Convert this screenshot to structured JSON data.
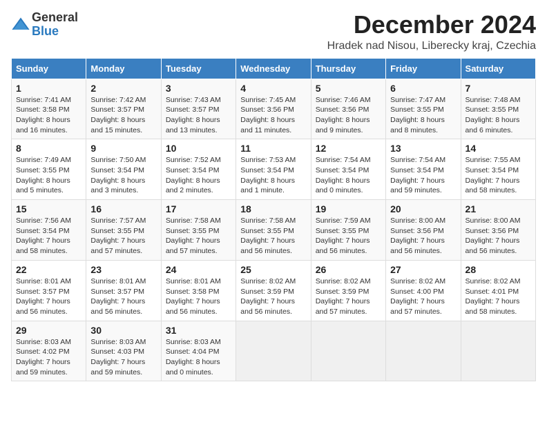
{
  "header": {
    "logo_general": "General",
    "logo_blue": "Blue",
    "title": "December 2024",
    "subtitle": "Hradek nad Nisou, Liberecky kraj, Czechia"
  },
  "weekdays": [
    "Sunday",
    "Monday",
    "Tuesday",
    "Wednesday",
    "Thursday",
    "Friday",
    "Saturday"
  ],
  "weeks": [
    [
      {
        "day": "1",
        "lines": [
          "Sunrise: 7:41 AM",
          "Sunset: 3:58 PM",
          "Daylight: 8 hours",
          "and 16 minutes."
        ]
      },
      {
        "day": "2",
        "lines": [
          "Sunrise: 7:42 AM",
          "Sunset: 3:57 PM",
          "Daylight: 8 hours",
          "and 15 minutes."
        ]
      },
      {
        "day": "3",
        "lines": [
          "Sunrise: 7:43 AM",
          "Sunset: 3:57 PM",
          "Daylight: 8 hours",
          "and 13 minutes."
        ]
      },
      {
        "day": "4",
        "lines": [
          "Sunrise: 7:45 AM",
          "Sunset: 3:56 PM",
          "Daylight: 8 hours",
          "and 11 minutes."
        ]
      },
      {
        "day": "5",
        "lines": [
          "Sunrise: 7:46 AM",
          "Sunset: 3:56 PM",
          "Daylight: 8 hours",
          "and 9 minutes."
        ]
      },
      {
        "day": "6",
        "lines": [
          "Sunrise: 7:47 AM",
          "Sunset: 3:55 PM",
          "Daylight: 8 hours",
          "and 8 minutes."
        ]
      },
      {
        "day": "7",
        "lines": [
          "Sunrise: 7:48 AM",
          "Sunset: 3:55 PM",
          "Daylight: 8 hours",
          "and 6 minutes."
        ]
      }
    ],
    [
      {
        "day": "8",
        "lines": [
          "Sunrise: 7:49 AM",
          "Sunset: 3:55 PM",
          "Daylight: 8 hours",
          "and 5 minutes."
        ]
      },
      {
        "day": "9",
        "lines": [
          "Sunrise: 7:50 AM",
          "Sunset: 3:54 PM",
          "Daylight: 8 hours",
          "and 3 minutes."
        ]
      },
      {
        "day": "10",
        "lines": [
          "Sunrise: 7:52 AM",
          "Sunset: 3:54 PM",
          "Daylight: 8 hours",
          "and 2 minutes."
        ]
      },
      {
        "day": "11",
        "lines": [
          "Sunrise: 7:53 AM",
          "Sunset: 3:54 PM",
          "Daylight: 8 hours",
          "and 1 minute."
        ]
      },
      {
        "day": "12",
        "lines": [
          "Sunrise: 7:54 AM",
          "Sunset: 3:54 PM",
          "Daylight: 8 hours",
          "and 0 minutes."
        ]
      },
      {
        "day": "13",
        "lines": [
          "Sunrise: 7:54 AM",
          "Sunset: 3:54 PM",
          "Daylight: 7 hours",
          "and 59 minutes."
        ]
      },
      {
        "day": "14",
        "lines": [
          "Sunrise: 7:55 AM",
          "Sunset: 3:54 PM",
          "Daylight: 7 hours",
          "and 58 minutes."
        ]
      }
    ],
    [
      {
        "day": "15",
        "lines": [
          "Sunrise: 7:56 AM",
          "Sunset: 3:54 PM",
          "Daylight: 7 hours",
          "and 58 minutes."
        ]
      },
      {
        "day": "16",
        "lines": [
          "Sunrise: 7:57 AM",
          "Sunset: 3:55 PM",
          "Daylight: 7 hours",
          "and 57 minutes."
        ]
      },
      {
        "day": "17",
        "lines": [
          "Sunrise: 7:58 AM",
          "Sunset: 3:55 PM",
          "Daylight: 7 hours",
          "and 57 minutes."
        ]
      },
      {
        "day": "18",
        "lines": [
          "Sunrise: 7:58 AM",
          "Sunset: 3:55 PM",
          "Daylight: 7 hours",
          "and 56 minutes."
        ]
      },
      {
        "day": "19",
        "lines": [
          "Sunrise: 7:59 AM",
          "Sunset: 3:55 PM",
          "Daylight: 7 hours",
          "and 56 minutes."
        ]
      },
      {
        "day": "20",
        "lines": [
          "Sunrise: 8:00 AM",
          "Sunset: 3:56 PM",
          "Daylight: 7 hours",
          "and 56 minutes."
        ]
      },
      {
        "day": "21",
        "lines": [
          "Sunrise: 8:00 AM",
          "Sunset: 3:56 PM",
          "Daylight: 7 hours",
          "and 56 minutes."
        ]
      }
    ],
    [
      {
        "day": "22",
        "lines": [
          "Sunrise: 8:01 AM",
          "Sunset: 3:57 PM",
          "Daylight: 7 hours",
          "and 56 minutes."
        ]
      },
      {
        "day": "23",
        "lines": [
          "Sunrise: 8:01 AM",
          "Sunset: 3:57 PM",
          "Daylight: 7 hours",
          "and 56 minutes."
        ]
      },
      {
        "day": "24",
        "lines": [
          "Sunrise: 8:01 AM",
          "Sunset: 3:58 PM",
          "Daylight: 7 hours",
          "and 56 minutes."
        ]
      },
      {
        "day": "25",
        "lines": [
          "Sunrise: 8:02 AM",
          "Sunset: 3:59 PM",
          "Daylight: 7 hours",
          "and 56 minutes."
        ]
      },
      {
        "day": "26",
        "lines": [
          "Sunrise: 8:02 AM",
          "Sunset: 3:59 PM",
          "Daylight: 7 hours",
          "and 57 minutes."
        ]
      },
      {
        "day": "27",
        "lines": [
          "Sunrise: 8:02 AM",
          "Sunset: 4:00 PM",
          "Daylight: 7 hours",
          "and 57 minutes."
        ]
      },
      {
        "day": "28",
        "lines": [
          "Sunrise: 8:02 AM",
          "Sunset: 4:01 PM",
          "Daylight: 7 hours",
          "and 58 minutes."
        ]
      }
    ],
    [
      {
        "day": "29",
        "lines": [
          "Sunrise: 8:03 AM",
          "Sunset: 4:02 PM",
          "Daylight: 7 hours",
          "and 59 minutes."
        ]
      },
      {
        "day": "30",
        "lines": [
          "Sunrise: 8:03 AM",
          "Sunset: 4:03 PM",
          "Daylight: 7 hours",
          "and 59 minutes."
        ]
      },
      {
        "day": "31",
        "lines": [
          "Sunrise: 8:03 AM",
          "Sunset: 4:04 PM",
          "Daylight: 8 hours",
          "and 0 minutes."
        ]
      },
      null,
      null,
      null,
      null
    ]
  ]
}
